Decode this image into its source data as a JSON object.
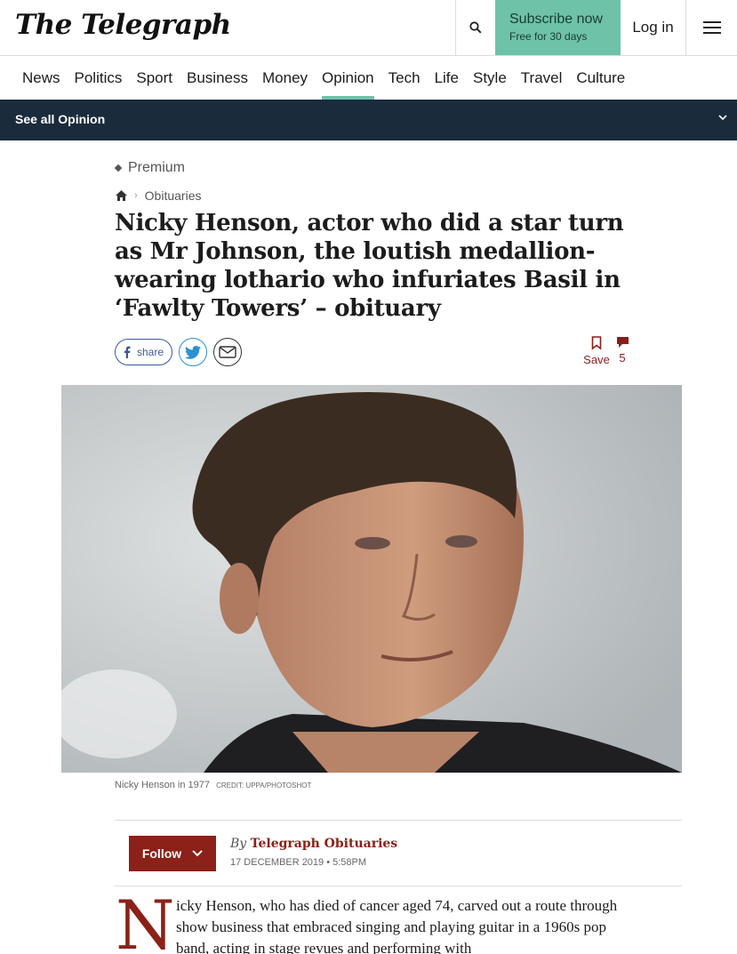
{
  "header": {
    "logo": "The Telegraph",
    "subscribe_label": "Subscribe now",
    "subscribe_sub": "Free for 30 days",
    "login_label": "Log in"
  },
  "nav": {
    "items": [
      "News",
      "Politics",
      "Sport",
      "Business",
      "Money",
      "Opinion",
      "Tech",
      "Life",
      "Style",
      "Travel",
      "Culture"
    ],
    "active": "Opinion"
  },
  "subnav": {
    "label": "See all Opinion"
  },
  "article": {
    "premium": "Premium",
    "breadcrumb": "Obituaries",
    "headline": "Nicky Henson, actor who did a star turn as Mr Johnson, the loutish medallion-wearing lothario who infuriates Basil in ‘Fawlty Towers’ – obituary",
    "share_label": "share",
    "save_label": "Save",
    "comment_count": "5",
    "caption": "Nicky Henson in 1977",
    "credit": "CREDIT: UPPA/PHOTOSHOT",
    "follow_label": "Follow",
    "byline_by": "By",
    "byline_name": "Telegraph Obituaries",
    "date": "17 DECEMBER 2019 • 5:58PM",
    "dropcap": "N",
    "body": "icky Henson, who has died of cancer aged 74, carved out a route through show business that embraced singing and playing guitar in a 1960s pop band, acting in stage revues and performing with"
  },
  "colors": {
    "accent": "#6ec2a8",
    "subnav_bg": "#1a2b3c",
    "brand_red": "#8b2118"
  }
}
